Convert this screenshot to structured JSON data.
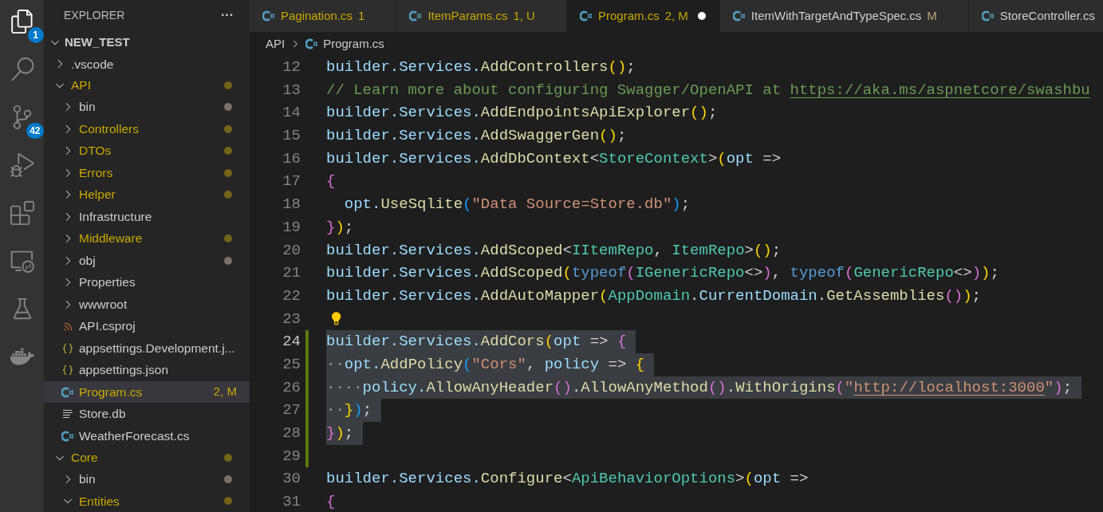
{
  "activity_bar": [
    {
      "kind": "files",
      "badge": "1",
      "selected": true
    },
    {
      "kind": "search",
      "selected": false
    },
    {
      "kind": "source-control",
      "badge": "42",
      "selected": false
    },
    {
      "kind": "run-debug",
      "selected": false
    },
    {
      "kind": "extensions",
      "selected": false
    },
    {
      "kind": "remote",
      "selected": false
    },
    {
      "kind": "testing",
      "selected": false
    },
    {
      "kind": "docker",
      "selected": false
    }
  ],
  "explorer": {
    "title": "EXPLORER",
    "more": "···",
    "root": {
      "label": "NEW_TEST",
      "expanded": true,
      "children": [
        {
          "label": ".vscode",
          "kind": "folder",
          "expanded": false,
          "modified": false,
          "ignored": false,
          "selected": false
        },
        {
          "label": "API",
          "kind": "folder",
          "expanded": true,
          "modified": true,
          "ignored": false,
          "selected": false,
          "children": [
            {
              "label": "bin",
              "kind": "folder",
              "expanded": false,
              "modified": false,
              "ignored": true,
              "selected": false
            },
            {
              "label": "Controllers",
              "kind": "folder",
              "expanded": false,
              "modified": true,
              "ignored": false,
              "selected": false
            },
            {
              "label": "DTOs",
              "kind": "folder",
              "expanded": false,
              "modified": true,
              "ignored": false,
              "selected": false
            },
            {
              "label": "Errors",
              "kind": "folder",
              "expanded": false,
              "modified": true,
              "ignored": false,
              "selected": false
            },
            {
              "label": "Helper",
              "kind": "folder",
              "expanded": false,
              "modified": true,
              "ignored": false,
              "selected": false
            },
            {
              "label": "Infrastructure",
              "kind": "folder",
              "expanded": false,
              "modified": false,
              "ignored": false,
              "selected": false
            },
            {
              "label": "Middleware",
              "kind": "folder",
              "expanded": false,
              "modified": true,
              "ignored": false,
              "selected": false
            },
            {
              "label": "obj",
              "kind": "folder",
              "expanded": false,
              "modified": false,
              "ignored": true,
              "selected": false
            },
            {
              "label": "Properties",
              "kind": "folder",
              "expanded": false,
              "modified": false,
              "ignored": false,
              "selected": false
            },
            {
              "label": "wwwroot",
              "kind": "folder",
              "expanded": false,
              "modified": false,
              "ignored": false,
              "selected": false
            },
            {
              "label": "API.csproj",
              "kind": "rss",
              "modified": false,
              "ignored": false,
              "selected": false
            },
            {
              "label": "appsettings.Development.j...",
              "kind": "json",
              "modified": false,
              "ignored": false,
              "selected": false
            },
            {
              "label": "appsettings.json",
              "kind": "json",
              "modified": false,
              "ignored": false,
              "selected": false
            },
            {
              "label": "Program.cs",
              "kind": "csharp",
              "modified": true,
              "ignored": false,
              "badge": "2, M",
              "selected": true
            },
            {
              "label": "Store.db",
              "kind": "text",
              "modified": false,
              "ignored": false,
              "selected": false
            },
            {
              "label": "WeatherForecast.cs",
              "kind": "csharp",
              "modified": false,
              "ignored": false,
              "selected": false
            }
          ]
        },
        {
          "label": "Core",
          "kind": "folder",
          "expanded": true,
          "modified": true,
          "ignored": false,
          "selected": false,
          "children": [
            {
              "label": "bin",
              "kind": "folder",
              "expanded": false,
              "modified": false,
              "ignored": true,
              "selected": false
            },
            {
              "label": "Entities",
              "kind": "folder",
              "expanded": true,
              "modified": true,
              "ignored": false,
              "selected": false
            }
          ]
        }
      ]
    }
  },
  "tabs": [
    {
      "label": "Pagination.cs",
      "badge": "1",
      "warning": true,
      "selected": false,
      "dirty": false
    },
    {
      "label": "ItemParams.cs",
      "badge": "1, U",
      "warning": true,
      "selected": false,
      "dirty": false
    },
    {
      "label": "Program.cs",
      "badge": "2, M",
      "warning": true,
      "selected": true,
      "dirty": true
    },
    {
      "label": "ItemWithTargetAndTypeSpec.cs",
      "badge": "M",
      "warning": false,
      "selected": false,
      "dirty": false
    },
    {
      "label": "StoreController.cs",
      "warning": false,
      "selected": false,
      "dirty": false
    }
  ],
  "breadcrumb": [
    {
      "label": "API",
      "kind": "folder"
    },
    {
      "label": "Program.cs",
      "kind": "csharp"
    }
  ],
  "editor": {
    "lines": [
      {
        "number": "12",
        "current": false,
        "selected": false,
        "added": false,
        "tokens": [
          {
            "kind": "var",
            "text": "builder.Services."
          },
          {
            "kind": "func",
            "text": "AddControllers"
          },
          {
            "kind": "b1",
            "text": "()"
          },
          {
            "kind": "punct",
            "text": ";"
          }
        ]
      },
      {
        "number": "13",
        "current": false,
        "selected": false,
        "added": false,
        "tokens": [
          {
            "kind": "comment",
            "text": "// Learn more about configuring Swagger/OpenAPI at "
          },
          {
            "kind": "link",
            "text": "https://aka.ms/aspnetcore/swashbu"
          }
        ]
      },
      {
        "number": "14",
        "current": false,
        "selected": false,
        "added": false,
        "tokens": [
          {
            "kind": "var",
            "text": "builder.Services."
          },
          {
            "kind": "func",
            "text": "AddEndpointsApiExplorer"
          },
          {
            "kind": "b1",
            "text": "()"
          },
          {
            "kind": "punct",
            "text": ";"
          }
        ]
      },
      {
        "number": "15",
        "current": false,
        "selected": false,
        "added": false,
        "tokens": [
          {
            "kind": "var",
            "text": "builder.Services."
          },
          {
            "kind": "func",
            "text": "AddSwaggerGen"
          },
          {
            "kind": "b1",
            "text": "()"
          },
          {
            "kind": "punct",
            "text": ";"
          }
        ]
      },
      {
        "number": "16",
        "current": false,
        "selected": false,
        "added": false,
        "tokens": [
          {
            "kind": "var",
            "text": "builder.Services."
          },
          {
            "kind": "func",
            "text": "AddDbContext"
          },
          {
            "kind": "punct",
            "text": "<"
          },
          {
            "kind": "type",
            "text": "StoreContext"
          },
          {
            "kind": "punct",
            "text": ">"
          },
          {
            "kind": "b1",
            "text": "("
          },
          {
            "kind": "var",
            "text": "opt"
          },
          {
            "kind": "punct",
            "text": " =>"
          }
        ]
      },
      {
        "number": "17",
        "current": false,
        "selected": false,
        "added": false,
        "tokens": [
          {
            "kind": "b2",
            "text": "{"
          }
        ]
      },
      {
        "number": "18",
        "current": false,
        "selected": false,
        "added": false,
        "tokens": [
          {
            "kind": "var",
            "text": "  opt."
          },
          {
            "kind": "func",
            "text": "UseSqlite"
          },
          {
            "kind": "b3",
            "text": "("
          },
          {
            "kind": "string",
            "text": "\"Data Source=Store.db\""
          },
          {
            "kind": "b3",
            "text": ")"
          },
          {
            "kind": "punct",
            "text": ";"
          }
        ]
      },
      {
        "number": "19",
        "current": false,
        "selected": false,
        "added": false,
        "tokens": [
          {
            "kind": "b2",
            "text": "}"
          },
          {
            "kind": "b1",
            "text": ")"
          },
          {
            "kind": "punct",
            "text": ";"
          }
        ]
      },
      {
        "number": "20",
        "current": false,
        "selected": false,
        "added": false,
        "tokens": [
          {
            "kind": "var",
            "text": "builder.Services."
          },
          {
            "kind": "func",
            "text": "AddScoped"
          },
          {
            "kind": "punct",
            "text": "<"
          },
          {
            "kind": "type",
            "text": "IItemRepo"
          },
          {
            "kind": "punct",
            "text": ", "
          },
          {
            "kind": "type",
            "text": "ItemRepo"
          },
          {
            "kind": "punct",
            "text": ">"
          },
          {
            "kind": "b1",
            "text": "()"
          },
          {
            "kind": "punct",
            "text": ";"
          }
        ]
      },
      {
        "number": "21",
        "current": false,
        "selected": false,
        "added": false,
        "tokens": [
          {
            "kind": "var",
            "text": "builder.Services."
          },
          {
            "kind": "func",
            "text": "AddScoped"
          },
          {
            "kind": "b1",
            "text": "("
          },
          {
            "kind": "keyword",
            "text": "typeof"
          },
          {
            "kind": "b2",
            "text": "("
          },
          {
            "kind": "type",
            "text": "IGenericRepo"
          },
          {
            "kind": "punct",
            "text": "<>"
          },
          {
            "kind": "b2",
            "text": ")"
          },
          {
            "kind": "punct",
            "text": ", "
          },
          {
            "kind": "keyword",
            "text": "typeof"
          },
          {
            "kind": "b2",
            "text": "("
          },
          {
            "kind": "type",
            "text": "GenericRepo"
          },
          {
            "kind": "punct",
            "text": "<>"
          },
          {
            "kind": "b2",
            "text": ")"
          },
          {
            "kind": "b1",
            "text": ")"
          },
          {
            "kind": "punct",
            "text": ";"
          }
        ]
      },
      {
        "number": "22",
        "current": false,
        "selected": false,
        "added": false,
        "tokens": [
          {
            "kind": "var",
            "text": "builder.Services."
          },
          {
            "kind": "func",
            "text": "AddAutoMapper"
          },
          {
            "kind": "b1",
            "text": "("
          },
          {
            "kind": "type",
            "text": "AppDomain"
          },
          {
            "kind": "punct",
            "text": "."
          },
          {
            "kind": "var",
            "text": "CurrentDomain"
          },
          {
            "kind": "punct",
            "text": "."
          },
          {
            "kind": "func",
            "text": "GetAssemblies"
          },
          {
            "kind": "b2",
            "text": "()"
          },
          {
            "kind": "b1",
            "text": ")"
          },
          {
            "kind": "punct",
            "text": ";"
          }
        ]
      },
      {
        "number": "23",
        "current": false,
        "selected": false,
        "added": false,
        "lightbulb": true
      },
      {
        "number": "24",
        "current": true,
        "selected": true,
        "added": true,
        "tokens": [
          {
            "kind": "var",
            "text": "builder.Services."
          },
          {
            "kind": "func",
            "text": "AddCors"
          },
          {
            "kind": "b1",
            "text": "("
          },
          {
            "kind": "var",
            "text": "opt"
          },
          {
            "kind": "punct",
            "text": " => "
          },
          {
            "kind": "b2",
            "text": "{"
          }
        ]
      },
      {
        "number": "25",
        "current": false,
        "selected": true,
        "added": true,
        "tokens": [
          {
            "kind": "space",
            "text": "··"
          },
          {
            "kind": "var",
            "text": "opt."
          },
          {
            "kind": "func",
            "text": "AddPolicy"
          },
          {
            "kind": "b3",
            "text": "("
          },
          {
            "kind": "string",
            "text": "\"Cors\""
          },
          {
            "kind": "punct",
            "text": ", "
          },
          {
            "kind": "var",
            "text": "policy"
          },
          {
            "kind": "punct",
            "text": " => "
          },
          {
            "kind": "b1",
            "text": "{"
          }
        ]
      },
      {
        "number": "26",
        "current": false,
        "selected": true,
        "added": true,
        "tokens": [
          {
            "kind": "space",
            "text": "····"
          },
          {
            "kind": "var",
            "text": "policy."
          },
          {
            "kind": "func",
            "text": "AllowAnyHeader"
          },
          {
            "kind": "b2",
            "text": "()"
          },
          {
            "kind": "punct",
            "text": "."
          },
          {
            "kind": "func",
            "text": "AllowAnyMethod"
          },
          {
            "kind": "b2",
            "text": "()"
          },
          {
            "kind": "punct",
            "text": "."
          },
          {
            "kind": "func",
            "text": "WithOrigins"
          },
          {
            "kind": "b2",
            "text": "("
          },
          {
            "kind": "string",
            "text": "\""
          },
          {
            "kind": "string-link",
            "text": "http://localhost:3000"
          },
          {
            "kind": "string",
            "text": "\""
          },
          {
            "kind": "b2",
            "text": ")"
          },
          {
            "kind": "punct",
            "text": ";"
          }
        ]
      },
      {
        "number": "27",
        "current": false,
        "selected": true,
        "added": true,
        "tokens": [
          {
            "kind": "space",
            "text": "··"
          },
          {
            "kind": "b1",
            "text": "}"
          },
          {
            "kind": "b3",
            "text": ")"
          },
          {
            "kind": "punct",
            "text": ";"
          }
        ]
      },
      {
        "number": "28",
        "current": false,
        "selected": true,
        "added": true,
        "tokens": [
          {
            "kind": "b2",
            "text": "}"
          },
          {
            "kind": "b1",
            "text": ")"
          },
          {
            "kind": "punct",
            "text": ";"
          }
        ]
      },
      {
        "number": "29",
        "current": false,
        "selected": false,
        "added": true
      },
      {
        "number": "30",
        "current": false,
        "selected": false,
        "added": false,
        "tokens": [
          {
            "kind": "var",
            "text": "builder.Services."
          },
          {
            "kind": "func",
            "text": "Configure"
          },
          {
            "kind": "punct",
            "text": "<"
          },
          {
            "kind": "type",
            "text": "ApiBehaviorOptions"
          },
          {
            "kind": "punct",
            "text": ">"
          },
          {
            "kind": "b1",
            "text": "("
          },
          {
            "kind": "var",
            "text": "opt"
          },
          {
            "kind": "punct",
            "text": " =>"
          }
        ]
      },
      {
        "number": "31",
        "current": false,
        "selected": false,
        "added": false,
        "tokens": [
          {
            "kind": "b2",
            "text": "{"
          }
        ]
      }
    ]
  }
}
